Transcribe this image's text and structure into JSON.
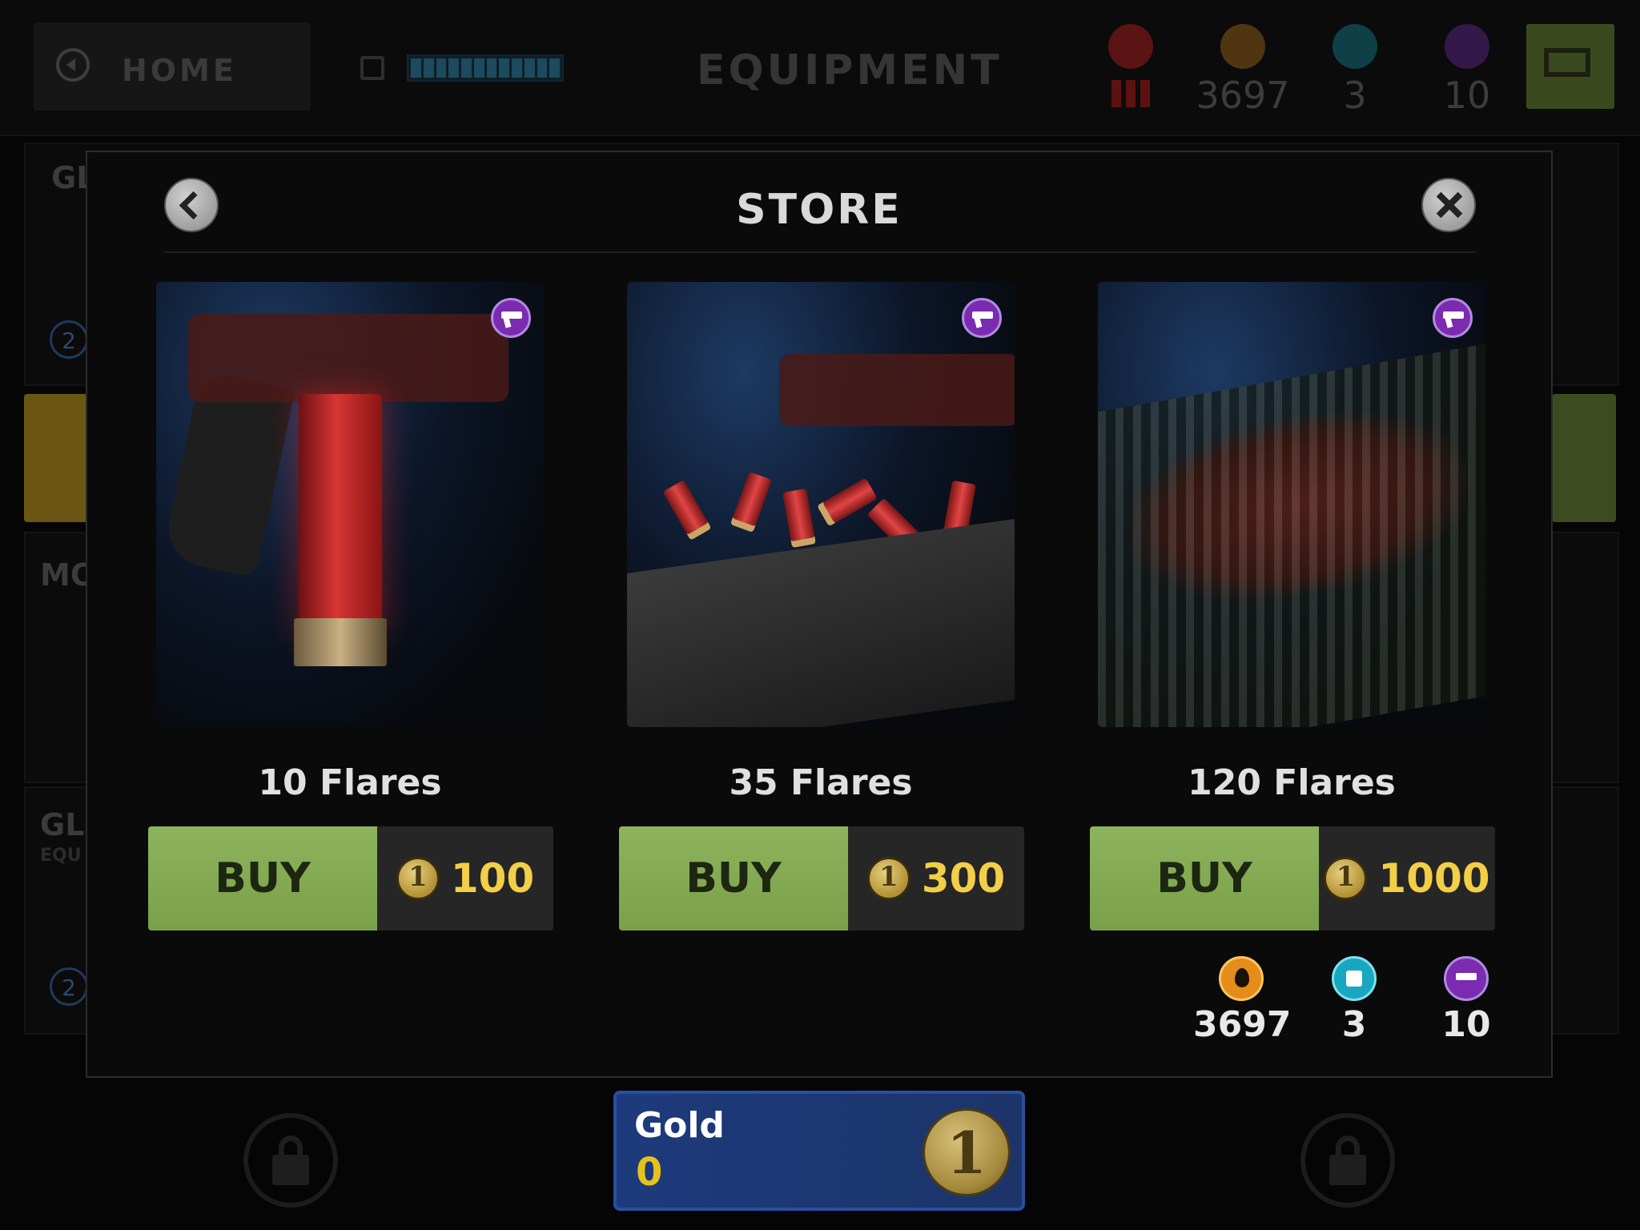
{
  "topbar": {
    "home_label": "HOME",
    "title": "EQUIPMENT",
    "currencies": [
      {
        "icon": "skull-icon",
        "value": ""
      },
      {
        "icon": "oil-drop-icon",
        "value": "3697"
      },
      {
        "icon": "fuel-can-icon",
        "value": "3"
      },
      {
        "icon": "flare-gun-icon",
        "value": "10"
      }
    ],
    "fuel_segments": 12
  },
  "background": {
    "labels": [
      "GL",
      "MO",
      "GL",
      "EQU"
    ],
    "badges": [
      "2",
      "2"
    ]
  },
  "store": {
    "title": "STORE",
    "items": [
      {
        "name": "10 Flares",
        "buy_label": "BUY",
        "price": "100"
      },
      {
        "name": "35 Flares",
        "buy_label": "BUY",
        "price": "300"
      },
      {
        "name": "120 Flares",
        "buy_label": "BUY",
        "price": "1000"
      }
    ],
    "balances": [
      {
        "icon": "oil-drop-icon",
        "value": "3697"
      },
      {
        "icon": "fuel-can-icon",
        "value": "3"
      },
      {
        "icon": "flare-gun-icon",
        "value": "10"
      }
    ]
  },
  "gold": {
    "label": "Gold",
    "value": "0"
  },
  "colors": {
    "buy_green": "#8db45d",
    "price_gold": "#f3cf47",
    "gold_panel_blue": "#1d3a7c",
    "badge_purple": "#7a2bb0"
  }
}
